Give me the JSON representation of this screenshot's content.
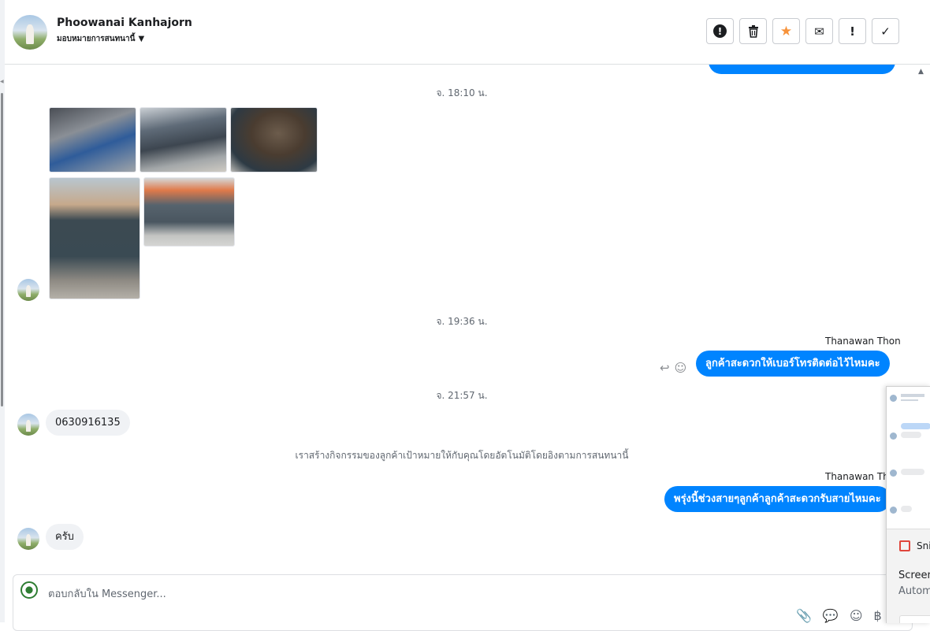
{
  "header": {
    "name": "Phoowanai Kanhajorn",
    "assign_label": "มอบหมายการสนทนานี้",
    "caret_icon": "caret-down-icon",
    "actions": [
      {
        "name": "spam-button",
        "icon": "alert-circle-icon",
        "glyph": "!"
      },
      {
        "name": "delete-button",
        "icon": "trash-icon",
        "glyph": "🗑"
      },
      {
        "name": "star-button",
        "icon": "star-icon",
        "glyph": "★"
      },
      {
        "name": "mark-unread-button",
        "icon": "envelope-icon",
        "glyph": "✉"
      },
      {
        "name": "important-button",
        "icon": "exclamation-icon",
        "glyph": "!"
      },
      {
        "name": "done-button",
        "icon": "check-icon",
        "glyph": "✓"
      }
    ]
  },
  "chat": {
    "timestamps": [
      "จ. 18:10 น.",
      "จ. 19:36 น.",
      "จ. 21:57 น."
    ],
    "messages": [
      {
        "sender": "Thanawan Thon",
        "text": "ลูกค้าสะดวกให้เบอร์โทรติดต่อไว้ไหมคะ"
      },
      {
        "text": "0630916135"
      },
      {
        "sender": "Thanawan Thon",
        "text": "พรุ่งนี้ช่วงสายๆลูกค้าลูกค้าสะดวกรับสายไหมคะ"
      },
      {
        "text": "ครับ"
      }
    ],
    "system_note": "เราสร้างกิจกรรมของลูกค้าเป้าหมายให้กับคุณโดยอัตโนมัติโดยอิงตามการสนทนานี้"
  },
  "composer": {
    "placeholder": "ตอบกลับใน Messenger...",
    "icons": [
      "paperclip-icon",
      "chat-bubble-icon",
      "emoji-icon",
      "baht-icon"
    ]
  },
  "snip_popup": {
    "app_name": "Snip",
    "line1": "Screen",
    "line2": "Autom"
  },
  "colors": {
    "accent": "#0084ff",
    "star": "#f7923a"
  }
}
